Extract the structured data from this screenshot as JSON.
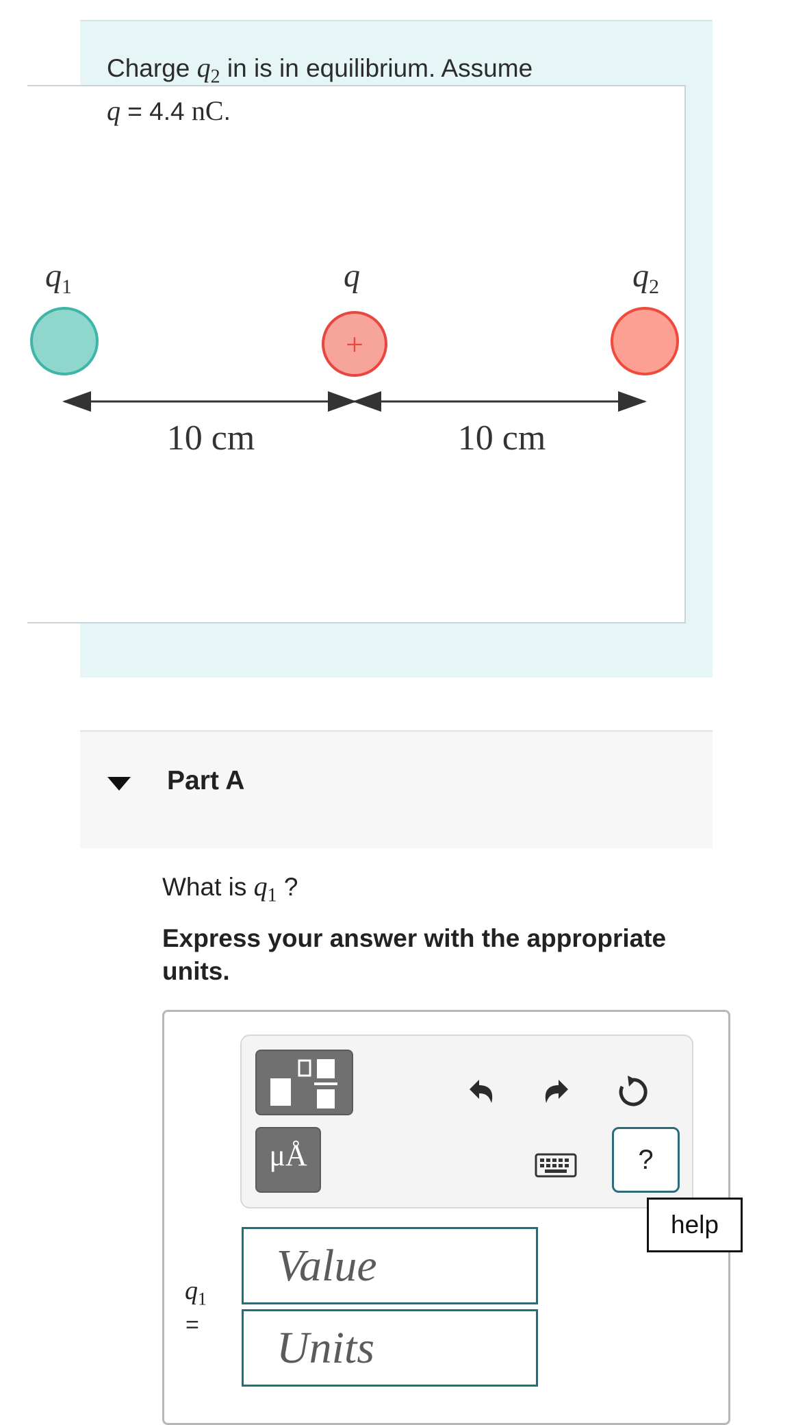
{
  "intro": {
    "line1_prefix": "Charge ",
    "line1_symbol": "q",
    "line1_sub": "2",
    "line1_suffix": " in is in equilibrium. Assume",
    "line2_symbol": "q",
    "line2_eq": " = 4.4 ",
    "line2_unit": "nC",
    "line2_end": "."
  },
  "figure": {
    "q1_label": "q",
    "q1_sub": "1",
    "q_label": "q",
    "q2_label": "q",
    "q2_sub": "2",
    "plus_sign": "+",
    "left_distance": "10 cm",
    "right_distance": "10 cm",
    "colors": {
      "q1_fill": "#8fd6cc",
      "q1_stroke": "#3fb5a8",
      "q_fill": "#f7a49a",
      "q_stroke": "#e8473f",
      "q2_fill": "#fba092",
      "q2_stroke": "#f04a3c"
    }
  },
  "part_a": {
    "title": "Part A",
    "caret_icon": "caret-down-icon"
  },
  "question": {
    "prefix": "What is ",
    "symbol": "q",
    "sub": "1",
    "suffix": " ?"
  },
  "instructions": "Express your answer with the appropriate units.",
  "toolbar": {
    "units_label": "μÅ",
    "help_q_label": "?",
    "icons": [
      "templates-icon",
      "units-icon",
      "undo-icon",
      "redo-icon",
      "reset-icon",
      "keyboard-icon"
    ]
  },
  "tooltip": {
    "label": "help"
  },
  "answer": {
    "var_symbol": "q",
    "var_sub": "1",
    "equals": "=",
    "value_placeholder": "Value",
    "units_placeholder": "Units"
  }
}
